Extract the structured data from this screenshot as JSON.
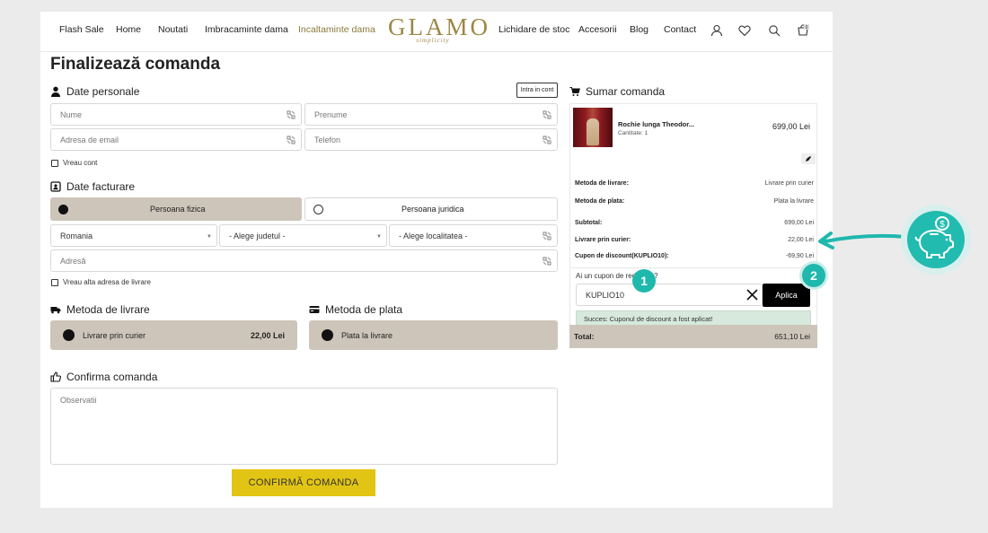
{
  "nav": {
    "links": [
      "Flash Sale",
      "Home",
      "Noutati",
      "Imbracaminte dama",
      "Incaltaminte dama",
      "Lichidare de stoc",
      "Accesorii",
      "Blog",
      "Contact"
    ],
    "logo": "GLAMO",
    "logo_tagline": "simplicity",
    "cart_count": "0"
  },
  "page_title": "Finalizează comanda",
  "personal": {
    "title": "Date personale",
    "login_button": "Intra in cont",
    "fields": {
      "first": "Nume",
      "last": "Prenume",
      "email": "Adresa de email",
      "phone": "Telefon"
    },
    "want_account": "Vreau cont"
  },
  "billing": {
    "title": "Date facturare",
    "person_individual": "Persoana fizica",
    "person_company": "Persoana juridica",
    "country": "Romania",
    "county_placeholder": "- Alege judetul -",
    "city_placeholder": "- Alege localitatea -",
    "address_placeholder": "Adresă",
    "other_address": "Vreau alta adresa de livrare"
  },
  "shipping": {
    "title": "Metoda de livrare",
    "option": "Livrare prin curier",
    "price": "22,00 Lei"
  },
  "payment": {
    "title": "Metoda de plata",
    "option": "Plata la livrare"
  },
  "confirm": {
    "title": "Confirma comanda",
    "notes_placeholder": "Observatii",
    "button": "CONFIRMĂ COMANDA"
  },
  "summary": {
    "title": "Sumar comanda",
    "product": {
      "name": "Rochie lunga Theodor...",
      "qty": "Cantitate: 1",
      "price": "699,00 Lei"
    },
    "rows": [
      {
        "label": "Metoda de livrare:",
        "value": "Livrare prin curier"
      },
      {
        "label": "Metoda de plata:",
        "value": "Plata la livrare"
      },
      {
        "label": "Subtotal:",
        "value": "699,00 Lei"
      },
      {
        "label": "Livrare prin curier:",
        "value": "22,00 Lei"
      },
      {
        "label": "Cupon de discount(KUPLIO10):",
        "value": "-69,90 Lei"
      }
    ],
    "coupon": {
      "question": "Ai un cupon de reducere?",
      "value": "KUPLIO10",
      "apply": "Aplica",
      "success": "Succes: Cuponul de discount a fost aplicat!"
    },
    "total_label": "Total:",
    "total_value": "651,10 Lei"
  },
  "annotations": {
    "step1": "1",
    "step2": "2"
  },
  "colors": {
    "accent_gold": "#9c8743",
    "beige": "#cdc5ba",
    "teal": "#1fb8ad",
    "confirm_yellow": "#e2c414",
    "success_bg": "#d7e8dc"
  }
}
